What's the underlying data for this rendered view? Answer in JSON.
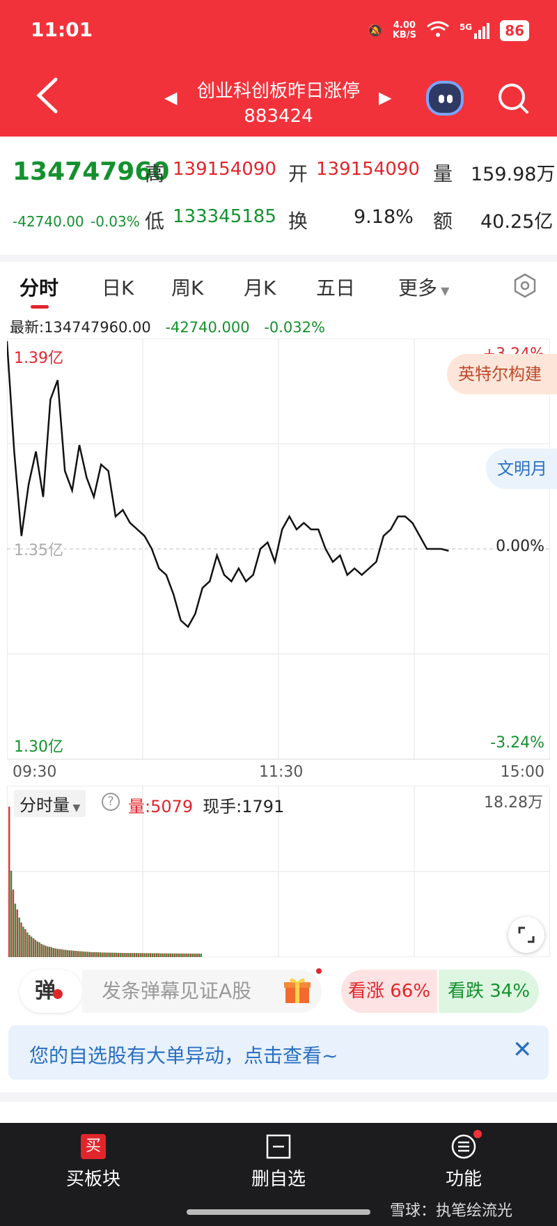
{
  "status_bar": {
    "time": "11:01",
    "speed_value": "4.00",
    "speed_unit": "KB/S",
    "network": "5G",
    "battery": "86"
  },
  "header": {
    "title": "创业科创板昨日涨停",
    "code": "883424"
  },
  "quote": {
    "price": "134747960",
    "change": "-42740.00",
    "change_pct": "-0.03%",
    "high_label": "高",
    "high": "139154090",
    "open_label": "开",
    "open": "139154090",
    "volume_label": "量",
    "volume": "159.98万",
    "low_label": "低",
    "low": "133345185",
    "turnover_label": "换",
    "turnover": "9.18%",
    "amount_label": "额",
    "amount": "40.25亿"
  },
  "tabs": [
    "分时",
    "日K",
    "周K",
    "月K",
    "五日",
    "更多"
  ],
  "latest": {
    "label": "最新:134747960.00",
    "change": "-42740.000",
    "pct": "-0.032%"
  },
  "chart_data": {
    "type": "line",
    "title": "",
    "x_ticks": [
      "09:30",
      "11:30",
      "15:00"
    ],
    "y_left_ticks": [
      "1.39亿",
      "1.35亿",
      "1.30亿"
    ],
    "y_right_ticks": [
      "+3.24%",
      "0.00%",
      "-3.24%"
    ],
    "ylim_pct": [
      -3.24,
      3.24
    ],
    "x_minutes_total": 240,
    "series": [
      {
        "x": [
          0,
          1,
          2,
          3,
          4,
          5,
          6,
          7,
          8,
          9,
          10,
          11,
          12,
          13,
          14,
          15,
          16,
          17,
          18,
          19,
          20,
          21,
          22,
          23,
          24,
          25,
          26,
          27,
          28,
          29,
          30,
          31,
          32,
          33,
          34,
          35,
          36,
          37,
          38,
          39,
          40,
          41,
          42,
          43,
          44,
          45,
          46,
          47,
          48,
          49,
          50,
          51,
          52,
          53,
          54,
          55,
          56,
          57,
          58,
          59,
          60,
          61,
          62,
          63,
          64,
          65,
          66,
          67,
          68,
          69,
          70,
          71,
          72,
          73,
          74,
          75,
          76,
          77,
          78,
          79,
          80,
          81,
          82,
          83,
          84,
          85,
          86,
          87,
          88,
          89,
          90,
          91,
          92,
          93,
          94,
          95
        ],
        "y": [
          3.2,
          1.5,
          0.2,
          1.0,
          1.5,
          0.8,
          2.3,
          2.6,
          1.2,
          0.9,
          1.6,
          1.1,
          0.8,
          1.3,
          1.2,
          0.5,
          0.6,
          0.4,
          0.3,
          0.2,
          0.0,
          -0.3,
          -0.4,
          -0.7,
          -1.1,
          -1.2,
          -1.0,
          -0.6,
          -0.5,
          -0.1,
          -0.4,
          -0.5,
          -0.3,
          -0.5,
          -0.4,
          0.0,
          0.1,
          -0.2,
          0.3,
          0.5,
          0.3,
          0.4,
          0.3,
          0.3,
          0.0,
          -0.2,
          -0.1,
          -0.4,
          -0.3,
          -0.4,
          -0.3,
          -0.2,
          0.2,
          0.3,
          0.5,
          0.5,
          0.4,
          0.2,
          0.0,
          0.0,
          0.0,
          -0.03,
          -0.03,
          -0.03,
          -0.03,
          -0.03,
          -0.03,
          -0.03,
          -0.03,
          -0.03,
          -0.03,
          -0.03,
          -0.03,
          -0.03,
          -0.03,
          -0.03,
          -0.03,
          -0.03,
          -0.03,
          -0.03,
          -0.03,
          -0.03,
          -0.03,
          -0.03,
          -0.03,
          -0.03,
          -0.03,
          -0.03,
          -0.03,
          -0.03,
          -0.03,
          -0.03,
          -0.03,
          -0.03,
          -0.03,
          -0.03
        ]
      }
    ],
    "volume": {
      "label": "分时量",
      "amount": "量:5079",
      "hand": "现手:1791",
      "max_label": "18.28万",
      "values": [
        18.28,
        10.5,
        8.2,
        6.5,
        5.8,
        4.8,
        4.2,
        3.7,
        3.4,
        3.0,
        2.7,
        2.5,
        2.3,
        2.1,
        1.9,
        1.8,
        1.6,
        1.5,
        1.4,
        1.3,
        1.25,
        1.2,
        1.1,
        1.05,
        1.0,
        0.98,
        0.95,
        0.9,
        0.88,
        0.85,
        0.82,
        0.8,
        0.78,
        0.76,
        0.74,
        0.72,
        0.7,
        0.68,
        0.66,
        0.64,
        0.62,
        0.6,
        0.6,
        0.6,
        0.58,
        0.58,
        0.56,
        0.56,
        0.55,
        0.55,
        0.54,
        0.54,
        0.53,
        0.53,
        0.52,
        0.52,
        0.51,
        0.51,
        0.5,
        0.5,
        0.5,
        0.5,
        0.5,
        0.5,
        0.49,
        0.49,
        0.49,
        0.48,
        0.48,
        0.48,
        0.48,
        0.47,
        0.47,
        0.47,
        0.47,
        0.46,
        0.46,
        0.46,
        0.46,
        0.45,
        0.45,
        0.45,
        0.45,
        0.45,
        0.44,
        0.44,
        0.44,
        0.44,
        0.44,
        0.43,
        0.43,
        0.43,
        0.43,
        0.43,
        0.42,
        0.42
      ],
      "colors": [
        "red",
        "green"
      ]
    }
  },
  "pills": {
    "top": "英特尔构建",
    "mid": "文明月"
  },
  "danmaku": {
    "btn": "弹",
    "placeholder": "发条弹幕见证A股"
  },
  "sentiment": {
    "bull": "看涨 66%",
    "bear": "看跌 34%"
  },
  "notice": {
    "text": "您的自选股有大单异动，点击查看~"
  },
  "bottom_nav": [
    {
      "label": "买板块",
      "icon_char": "买"
    },
    {
      "label": "删自选"
    },
    {
      "label": "功能"
    }
  ],
  "watermark": "雪球：执笔绘流光",
  "colors": {
    "up": "#e0262b",
    "down": "#14912e",
    "header": "#f2323a"
  }
}
